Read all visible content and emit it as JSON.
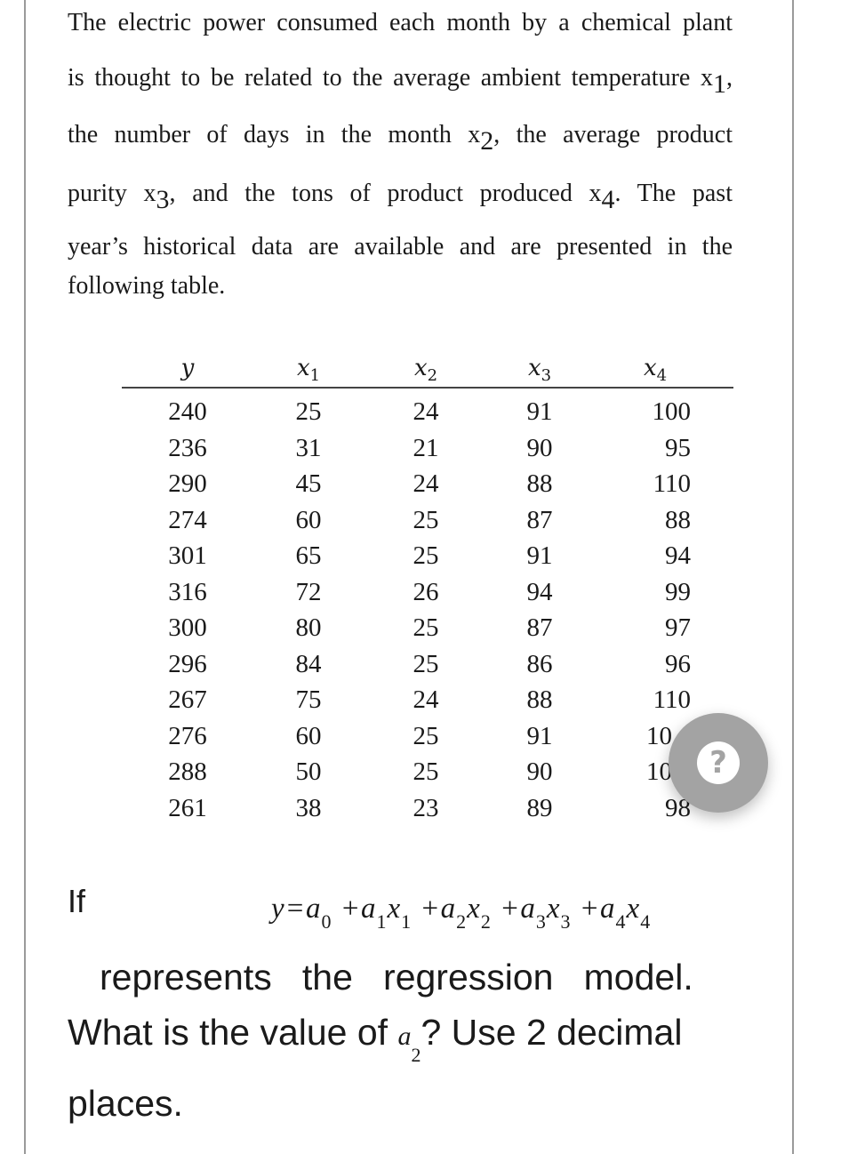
{
  "intro": {
    "lines": [
      [
        "The electric power consumed each month by a chemical plant"
      ],
      [
        "is thought to be related to the average ambient temperature x",
        "1",
        ","
      ],
      [
        "the number of days in the month x",
        "2",
        ", the average product"
      ],
      [
        "purity x",
        "3",
        ", and the tons of product produced x",
        "4",
        ". The past"
      ],
      [
        "year’s historical data are available and are presented in the"
      ],
      [
        "following table."
      ]
    ]
  },
  "table": {
    "headers": [
      {
        "var": "y",
        "sub": ""
      },
      {
        "var": "x",
        "sub": "1"
      },
      {
        "var": "x",
        "sub": "2"
      },
      {
        "var": "x",
        "sub": "3"
      },
      {
        "var": "x",
        "sub": "4"
      }
    ],
    "rows": [
      [
        "240",
        "25",
        "24",
        "91",
        "100"
      ],
      [
        "236",
        "31",
        "21",
        "90",
        "95"
      ],
      [
        "290",
        "45",
        "24",
        "88",
        "110"
      ],
      [
        "274",
        "60",
        "25",
        "87",
        "88"
      ],
      [
        "301",
        "65",
        "25",
        "91",
        "94"
      ],
      [
        "316",
        "72",
        "26",
        "94",
        "99"
      ],
      [
        "300",
        "80",
        "25",
        "87",
        "97"
      ],
      [
        "296",
        "84",
        "25",
        "86",
        "96"
      ],
      [
        "267",
        "75",
        "24",
        "88",
        "110"
      ],
      [
        "276",
        "60",
        "25",
        "91",
        "10"
      ],
      [
        "288",
        "50",
        "25",
        "90",
        "10"
      ],
      [
        "261",
        "38",
        "23",
        "89",
        "98"
      ]
    ]
  },
  "help_button": {
    "icon": "question-mark-icon",
    "glyph": "?",
    "color": "#a3a3a3"
  },
  "question": {
    "if": "If",
    "equation": {
      "y": "y",
      "eq": "=",
      "a": "a",
      "x": "x",
      "plus": "+",
      "subs": [
        "0",
        "1",
        "2",
        "3",
        "4"
      ]
    },
    "line2": "represents   the   regression   model.",
    "line3_pre": "What is the value of ",
    "line3_var": "a",
    "line3_sub": "2",
    "line3_post": "? Use 2 decimal",
    "line4": "places."
  }
}
